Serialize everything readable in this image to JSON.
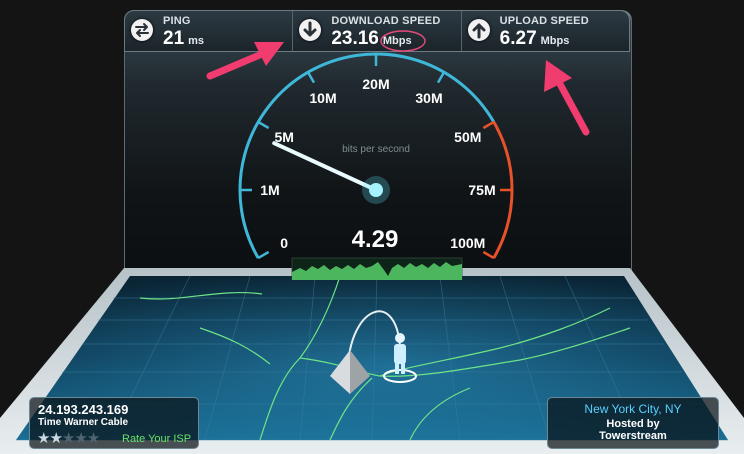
{
  "stats": {
    "ping": {
      "label": "PING",
      "value": "21",
      "unit": "ms",
      "icon": "ping-icon"
    },
    "download": {
      "label": "DOWNLOAD SPEED",
      "value": "23.16",
      "unit": "Mbps",
      "icon": "download-arrow-icon"
    },
    "upload": {
      "label": "UPLOAD SPEED",
      "value": "6.27",
      "unit": "Mbps",
      "icon": "upload-arrow-icon"
    }
  },
  "gauge": {
    "caption": "bits per second",
    "readout": "4.29",
    "needle_value_mbps": 4.29,
    "ticks": [
      "0",
      "1M",
      "5M",
      "10M",
      "20M",
      "30M",
      "50M",
      "75M",
      "100M"
    ],
    "colors": {
      "normal": "#3fb7d8",
      "high": "#e8522a",
      "needle": "#e9fbff"
    }
  },
  "isp": {
    "ip": "24.193.243.169",
    "name": "Time Warner Cable",
    "rating_stars": 2,
    "max_stars": 5,
    "rate_label": "Rate Your ISP"
  },
  "server": {
    "city": "New York City, NY",
    "hosted_by": "Hosted by",
    "host": "Towerstream"
  },
  "annotations": {
    "color": "#f03c6e"
  }
}
